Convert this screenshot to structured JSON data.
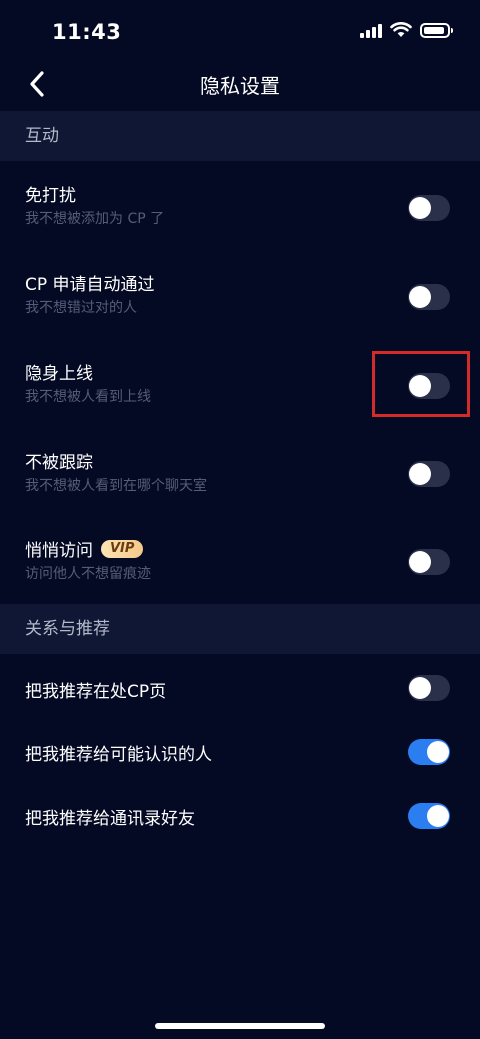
{
  "status_bar": {
    "time": "11:43",
    "icons": [
      "signal-icon",
      "wifi-icon",
      "battery-icon"
    ]
  },
  "nav": {
    "title": "隐私设置",
    "back_icon": "chevron-left-icon"
  },
  "sections": [
    {
      "header": "互动",
      "items": [
        {
          "title": "免打扰",
          "subtitle": "我不想被添加为 CP 了",
          "toggle_on": false
        },
        {
          "title": "CP 申请自动通过",
          "subtitle": "我不想错过对的人",
          "toggle_on": false
        },
        {
          "title": "隐身上线",
          "subtitle": "我不想被人看到上线",
          "toggle_on": false,
          "highlighted": true
        },
        {
          "title": "不被跟踪",
          "subtitle": "我不想被人看到在哪个聊天室",
          "toggle_on": false
        },
        {
          "title": "悄悄访问",
          "badge": "VIP",
          "subtitle": "访问他人不想留痕迹",
          "toggle_on": false
        }
      ]
    },
    {
      "header": "关系与推荐",
      "items": [
        {
          "title": "把我推荐在处CP页",
          "toggle_on": false
        },
        {
          "title": "把我推荐给可能认识的人",
          "toggle_on": true
        },
        {
          "title": "把我推荐给通讯录好友",
          "toggle_on": true
        }
      ]
    }
  ],
  "colors": {
    "background": "#050a24",
    "section_header_bg": "#0f1735",
    "toggle_on": "#2b7ef0",
    "toggle_off": "#2a2f4a",
    "highlight": "#d42a2a"
  }
}
